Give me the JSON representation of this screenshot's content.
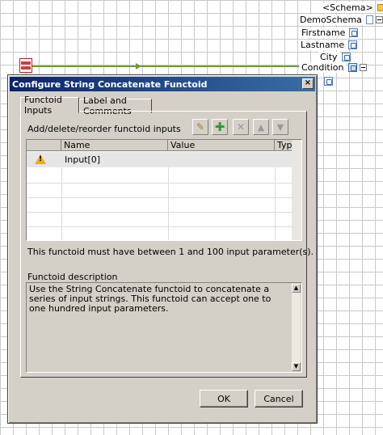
{
  "schema_tree": {
    "root": "<Schema>",
    "node": "DemoSchema",
    "fields": [
      "Firstname",
      "Lastname",
      "City",
      "Condition"
    ]
  },
  "dialog": {
    "title": "Configure String Concatenate Functoid",
    "close_glyph": "×",
    "tabs": [
      "Functoid Inputs",
      "Label and Comments"
    ],
    "instructions": "Add/delete/reorder functoid inputs",
    "table": {
      "columns": [
        "Name",
        "Value",
        "Type"
      ],
      "rows": [
        {
          "name": "Input[0]",
          "value": "",
          "type": ""
        }
      ]
    },
    "validation": "This functoid must have between 1 and 100 input parameter(s).",
    "description_label": "Functoid description",
    "description": "Use the String Concatenate functoid to concatenate a series of input strings. This functoid can accept one to one hundred input parameters.",
    "ok_label": "OK",
    "cancel_label": "Cancel"
  },
  "icons": [
    "folder-icon",
    "collapse-icon",
    "schema-node-icon",
    "field-icon",
    "pencil-icon",
    "add-icon",
    "delete-icon",
    "move-up-icon",
    "move-down-icon",
    "warning-icon",
    "functoid-icon"
  ],
  "colors": {
    "titlebar_start": "#0a246a",
    "titlebar_end": "#3a6ea5",
    "dialog_bg": "#d4d0c8",
    "link": "#6f9a3e",
    "add_green": "#2c9a2c"
  }
}
